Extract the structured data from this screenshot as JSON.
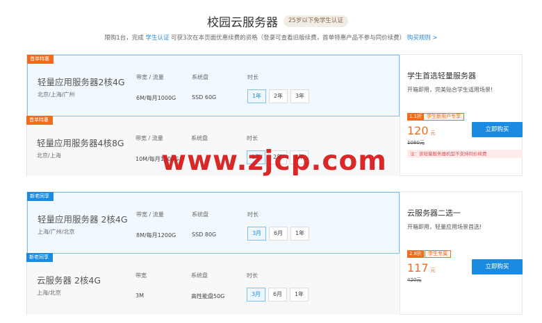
{
  "header": {
    "title": "校园云服务器",
    "badge": "25岁以下免学生认证",
    "subtitle_pre": "限购1台，完成 ",
    "subtitle_link": "学生认证",
    "subtitle_mid": " 可获3次在本页面优惠续费的资格（登录可查看旧版续费，首单特惠产品不参与同价续费）",
    "rules_link": "购买规则 >"
  },
  "groups": [
    {
      "rows": [
        {
          "tag": "首单特惠",
          "name": "轻量应用服务器2核4G",
          "region": "北京/上海/广州",
          "col1_label": "带宽 / 流量",
          "col1_value": "6M/每月1000G",
          "col2_label": "系统盘",
          "col2_value": "SSD 60G",
          "col3_label": "时长",
          "durations": [
            "1年",
            "2年",
            "3年"
          ],
          "selected": "1年"
        },
        {
          "tag": "首单特惠",
          "name": "轻量应用服务器4核8G",
          "region": "北京/上海",
          "col1_label": "带宽 / 流量",
          "col1_value": "10M/每月1500G",
          "col2_label": "系统盘",
          "col2_value": "",
          "col3_label": "时长",
          "durations": [
            "1年",
            "2年",
            "3年"
          ],
          "selected": "1年"
        }
      ],
      "side": {
        "title": "学生首选轻量服务器",
        "desc": "开箱即用，完美贴合学生适用场景!",
        "discount": "1.1折",
        "discount_tag": "学生新用户专享",
        "price": "120",
        "price_unit": "元",
        "original_price": "1080元",
        "buy_label": "立即购买",
        "note": "注：该轻量服务器机型不支持同价续费"
      }
    },
    {
      "rows": [
        {
          "tag": "新老同享",
          "name": "轻量应用服务器 2核4G",
          "region": "上海/广州/北京",
          "col1_label": "带宽 / 流量",
          "col1_value": "8M/每月1200G",
          "col2_label": "系统盘",
          "col2_value": "SSD 80G",
          "col3_label": "时长",
          "durations": [
            "3月",
            "6月",
            "1年"
          ],
          "selected": "3月"
        },
        {
          "tag": "新老同享",
          "name": "云服务器 2核4G",
          "region": "上海/北京",
          "col1_label": "带宽",
          "col1_value": "3M",
          "col2_label": "系统盘",
          "col2_value": "高性能盘50G",
          "col3_label": "时长",
          "durations": [
            "3月",
            "6月",
            "1年"
          ],
          "selected": "3月"
        }
      ],
      "side": {
        "title": "云服务器二选一",
        "desc": "开箱即用，轻量应用场景首选!",
        "discount": "2.8折",
        "discount_tag": "学生专属",
        "price": "117",
        "price_unit": "元",
        "original_price": "420元",
        "buy_label": "立即购买",
        "note": ""
      }
    }
  ],
  "watermark": "www.zjcp.com",
  "colors": {
    "accent": "#1a8be0",
    "orange": "#f26a1b",
    "watermark": "#d61616"
  }
}
